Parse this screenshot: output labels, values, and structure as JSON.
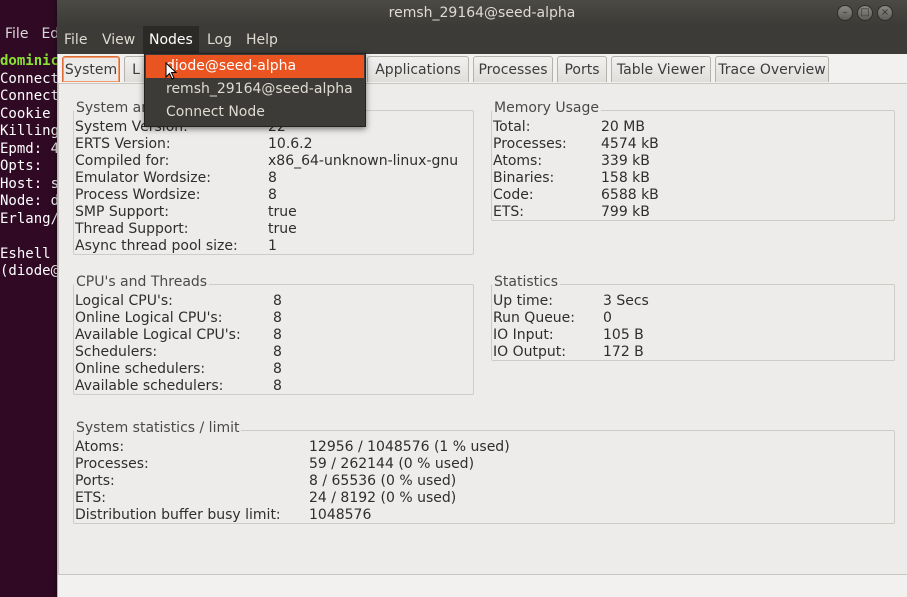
{
  "terminal": {
    "menu": [
      "File",
      "Ed"
    ],
    "lines": [
      "dominic",
      "Connect",
      "Connect",
      "Cookie",
      "Killing",
      "Epmd: 4",
      "Opts: ",
      "Host: s",
      "Node: d",
      "Erlang/",
      "",
      "Eshell",
      "(diode@"
    ]
  },
  "window": {
    "title": "remsh_29164@seed-alpha",
    "buttons": {
      "minimize": "–",
      "maximize": "□",
      "close": "×"
    }
  },
  "menubar": {
    "file": "File",
    "view": "View",
    "nodes": "Nodes",
    "log": "Log",
    "help": "Help"
  },
  "nodes_menu": {
    "items": [
      "diode@seed-alpha",
      "remsh_29164@seed-alpha",
      "Connect Node"
    ]
  },
  "tabs": [
    "System",
    "L",
    "Applications",
    "Processes",
    "Ports",
    "Table Viewer",
    "Trace Overview"
  ],
  "system": {
    "title": "System an",
    "rows": [
      {
        "k": "System Version:",
        "v": "22"
      },
      {
        "k": "ERTS Version:",
        "v": "10.6.2"
      },
      {
        "k": "Compiled for:",
        "v": "x86_64-unknown-linux-gnu"
      },
      {
        "k": "Emulator Wordsize:",
        "v": "8"
      },
      {
        "k": "Process Wordsize:",
        "v": "8"
      },
      {
        "k": "SMP Support:",
        "v": "true"
      },
      {
        "k": "Thread Support:",
        "v": "true"
      },
      {
        "k": "Async thread pool size:",
        "v": "1"
      }
    ]
  },
  "memory": {
    "title": "Memory Usage",
    "rows": [
      {
        "k": "Total:",
        "v": "20 MB"
      },
      {
        "k": "Processes:",
        "v": "4574 kB"
      },
      {
        "k": "Atoms:",
        "v": "339 kB"
      },
      {
        "k": "Binaries:",
        "v": "158 kB"
      },
      {
        "k": "Code:",
        "v": "6588 kB"
      },
      {
        "k": "ETS:",
        "v": "799 kB"
      }
    ]
  },
  "cpu": {
    "title": "CPU's and Threads",
    "rows": [
      {
        "k": "Logical CPU's:",
        "v": "8"
      },
      {
        "k": "Online Logical CPU's:",
        "v": "8"
      },
      {
        "k": "Available Logical CPU's:",
        "v": "8"
      },
      {
        "k": "Schedulers:",
        "v": "8"
      },
      {
        "k": "Online schedulers:",
        "v": "8"
      },
      {
        "k": "Available schedulers:",
        "v": "8"
      }
    ]
  },
  "statistics": {
    "title": "Statistics",
    "rows": [
      {
        "k": "Up time:",
        "v": "3 Secs"
      },
      {
        "k": "Run Queue:",
        "v": "0"
      },
      {
        "k": "IO Input:",
        "v": "105 B"
      },
      {
        "k": "IO Output:",
        "v": "172 B"
      }
    ]
  },
  "limits": {
    "title": "System statistics / limit",
    "rows": [
      {
        "k": "Atoms:",
        "v": "12956 / 1048576 (1 % used)"
      },
      {
        "k": "Processes:",
        "v": "59 / 262144 (0 % used)"
      },
      {
        "k": "Ports:",
        "v": "8 / 65536 (0 % used)"
      },
      {
        "k": "ETS:",
        "v": "24 / 8192 (0 % used)"
      },
      {
        "k": "Distribution buffer busy limit:",
        "v": "1048576"
      }
    ]
  },
  "colors": {
    "accent": "#e95420",
    "terminal_bg": "#300a24",
    "titlebar": "#3c3b37"
  }
}
